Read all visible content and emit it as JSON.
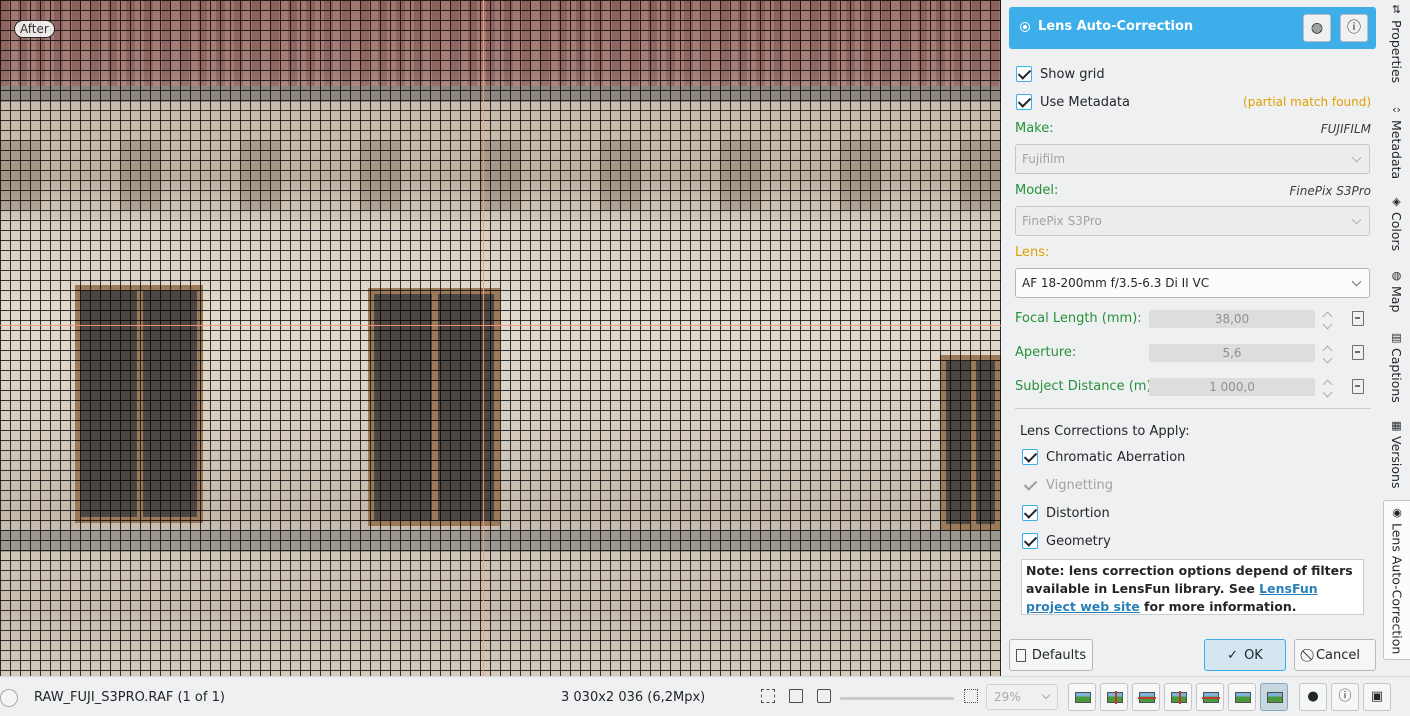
{
  "canvas": {
    "after_label": "After"
  },
  "tool": {
    "title": "Lens Auto-Correction",
    "show_grid": {
      "label": "Show grid",
      "checked": true
    },
    "use_metadata": {
      "label": "Use Metadata",
      "checked": true,
      "status": "(partial match found)"
    },
    "make": {
      "label": "Make:",
      "metadata_value": "FUJIFILM",
      "selected": "Fujifilm"
    },
    "model": {
      "label": "Model:",
      "metadata_value": "FinePix S3Pro",
      "selected": "FinePix S3Pro"
    },
    "lens": {
      "label": "Lens:",
      "selected": "AF 18-200mm f/3.5-6.3 Di II VC"
    },
    "focal_length": {
      "label": "Focal Length (mm):",
      "value": "38,00"
    },
    "aperture": {
      "label": "Aperture:",
      "value": "5,6"
    },
    "subject_distance": {
      "label": "Subject Distance (m):",
      "value": "1 000,0"
    },
    "corrections_title": "Lens Corrections to Apply:",
    "corrections": [
      {
        "label": "Chromatic Aberration",
        "checked": true,
        "enabled": true
      },
      {
        "label": "Vignetting",
        "checked": true,
        "enabled": false
      },
      {
        "label": "Distortion",
        "checked": true,
        "enabled": true
      },
      {
        "label": "Geometry",
        "checked": true,
        "enabled": true
      }
    ],
    "note": {
      "prefix": "Note: lens correction options depend of filters available in LensFun library. See ",
      "link": "LensFun project web site",
      "suffix": " for more information."
    },
    "buttons": {
      "defaults": "Defaults",
      "ok": "OK",
      "cancel": "Cancel"
    }
  },
  "right_tabs": [
    {
      "label": "Properties",
      "icon": "properties-icon"
    },
    {
      "label": "Metadata",
      "icon": "metadata-icon"
    },
    {
      "label": "Colors",
      "icon": "colors-icon"
    },
    {
      "label": "Map",
      "icon": "map-icon"
    },
    {
      "label": "Captions",
      "icon": "captions-icon"
    },
    {
      "label": "Versions",
      "icon": "versions-icon"
    },
    {
      "label": "Lens Auto-Correction",
      "icon": "lens-icon",
      "active": true
    }
  ],
  "statusbar": {
    "filename": "RAW_FUJI_S3PRO.RAF (1 of 1)",
    "dimensions": "3 030x2 036 (6,2Mpx)",
    "zoom": "29%"
  },
  "colors": {
    "accent": "#3daee9",
    "label_green": "#27913a",
    "label_orange": "#e0a000",
    "link": "#2980b9"
  }
}
